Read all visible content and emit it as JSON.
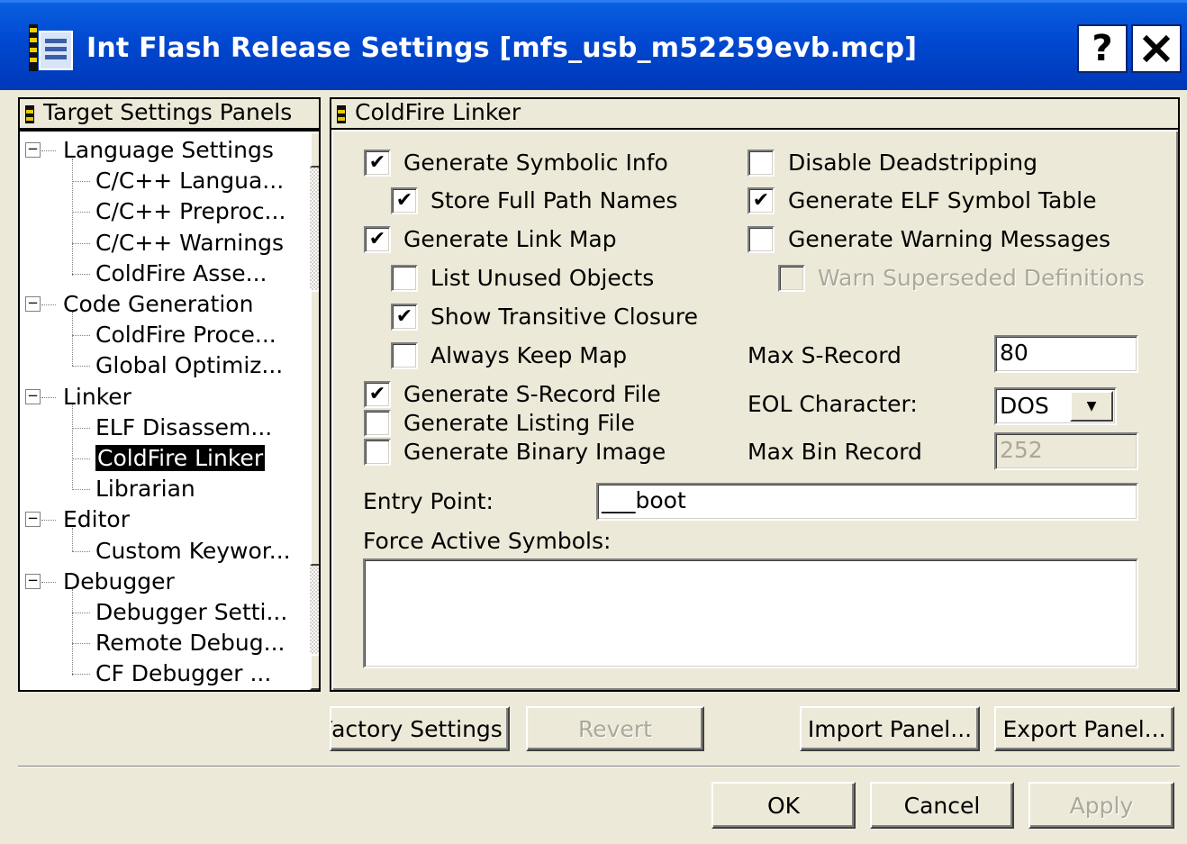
{
  "window": {
    "title": "Int Flash Release Settings [mfs_usb_m52259evb.mcp]",
    "help_label": "?",
    "close_label": "✕"
  },
  "tree": {
    "header": "Target Settings Panels",
    "items": [
      {
        "label": "Language Settings",
        "type": "category"
      },
      {
        "label": "C/C++ Langua...",
        "type": "leaf"
      },
      {
        "label": "C/C++ Preproc...",
        "type": "leaf"
      },
      {
        "label": "C/C++ Warnings",
        "type": "leaf"
      },
      {
        "label": "ColdFire Asse...",
        "type": "leaf"
      },
      {
        "label": "Code Generation",
        "type": "category"
      },
      {
        "label": "ColdFire Proce...",
        "type": "leaf"
      },
      {
        "label": "Global Optimiz...",
        "type": "leaf"
      },
      {
        "label": "Linker",
        "type": "category"
      },
      {
        "label": "ELF Disassem...",
        "type": "leaf"
      },
      {
        "label": "ColdFire Linker",
        "type": "leaf",
        "selected": true
      },
      {
        "label": "Librarian",
        "type": "leaf"
      },
      {
        "label": "Editor",
        "type": "category"
      },
      {
        "label": "Custom Keywor...",
        "type": "leaf"
      },
      {
        "label": "Debugger",
        "type": "category"
      },
      {
        "label": "Debugger Setti...",
        "type": "leaf"
      },
      {
        "label": "Remote Debug...",
        "type": "leaf"
      },
      {
        "label": "CF Debugger ...",
        "type": "leaf"
      }
    ]
  },
  "panel": {
    "header": "ColdFire Linker",
    "options": {
      "generate_symbolic_info": {
        "label": "Generate Symbolic Info",
        "checked": true
      },
      "store_full_path_names": {
        "label": "Store Full Path Names",
        "checked": true
      },
      "generate_link_map": {
        "label": "Generate Link Map",
        "checked": true
      },
      "list_unused_objects": {
        "label": "List Unused Objects",
        "checked": false
      },
      "show_transitive_closure": {
        "label": "Show Transitive Closure",
        "checked": true
      },
      "always_keep_map": {
        "label": "Always Keep Map",
        "checked": false
      },
      "generate_srecord_file": {
        "label": "Generate S-Record File",
        "checked": true
      },
      "generate_listing_file": {
        "label": "Generate Listing File",
        "checked": false
      },
      "generate_binary_image": {
        "label": "Generate Binary Image",
        "checked": false
      },
      "disable_deadstripping": {
        "label": "Disable Deadstripping",
        "checked": false
      },
      "generate_elf_symbol_table": {
        "label": "Generate ELF Symbol Table",
        "checked": true
      },
      "generate_warning_messages": {
        "label": "Generate Warning Messages",
        "checked": false
      },
      "warn_superseded_definitions": {
        "label": "Warn Superseded Definitions",
        "checked": false,
        "disabled": true
      }
    },
    "max_srecord": {
      "label": "Max S-Record",
      "value": "80"
    },
    "eol_character": {
      "label": "EOL Character:",
      "value": "DOS"
    },
    "max_bin_record": {
      "label": "Max Bin Record",
      "value": "252"
    },
    "entry_point": {
      "label": "Entry Point:",
      "value": "___boot"
    },
    "force_active_symbols": {
      "label": "Force Active Symbols:",
      "value": ""
    }
  },
  "buttons": {
    "factory_settings": "Factory Settings",
    "revert": "Revert",
    "import_panel": "Import Panel...",
    "export_panel": "Export Panel...",
    "ok": "OK",
    "cancel": "Cancel",
    "apply": "Apply"
  },
  "check_mark": "✔"
}
